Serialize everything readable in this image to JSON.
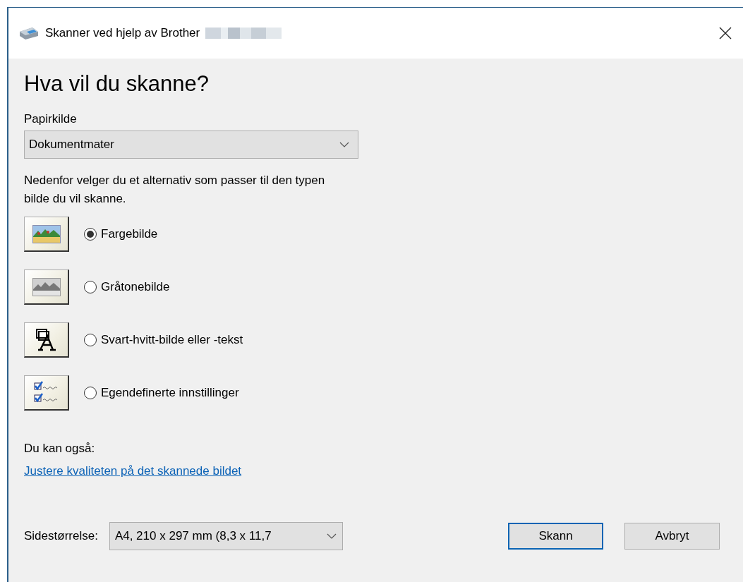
{
  "window": {
    "title": "Skanner ved hjelp av Brother"
  },
  "heading": "Hva vil du skanne?",
  "paper_source": {
    "label": "Papirkilde",
    "value": "Dokumentmater"
  },
  "instructions": "Nedenfor velger du et alternativ som passer til den typen bilde du vil skanne.",
  "options": [
    {
      "kind": "color",
      "label": "Fargebilde",
      "selected": true
    },
    {
      "kind": "grayscale",
      "label": "Gråtonebilde",
      "selected": false
    },
    {
      "kind": "blackwhite",
      "label": "Svart-hvitt-bilde eller -tekst",
      "selected": false
    },
    {
      "kind": "custom",
      "label": "Egendefinerte innstillinger",
      "selected": false
    }
  ],
  "also": {
    "label": "Du kan også:",
    "link": "Justere kvaliteten på det skannede bildet"
  },
  "page_size": {
    "label": "Sidestørrelse:",
    "value": "A4, 210 x 297 mm (8,3 x 11,7"
  },
  "buttons": [
    {
      "label": "Skann",
      "default": true
    },
    {
      "label": "Avbryt",
      "default": false
    }
  ]
}
